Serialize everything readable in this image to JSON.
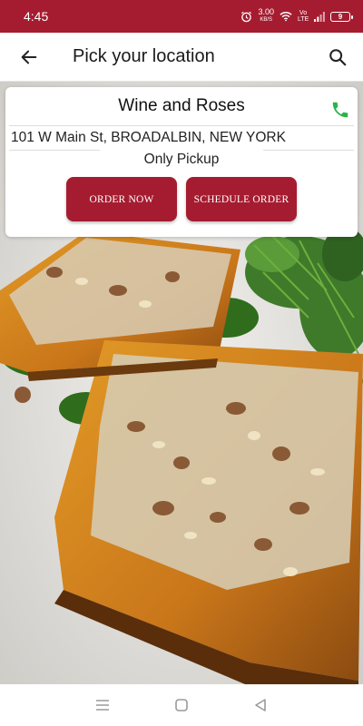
{
  "status_bar": {
    "time": "4:45",
    "net_speed": "3.00",
    "net_unit": "KB/S",
    "signal_label": "Vo LTE",
    "battery": "9"
  },
  "app_bar": {
    "title": "Pick your location"
  },
  "store": {
    "name": "Wine and Roses",
    "address": "101 W Main St, BROADALBIN, NEW YORK",
    "pickup_label": "Only Pickup",
    "order_now_label": "ORDER NOW",
    "schedule_order_label": "SCHEDULE ORDER"
  },
  "colors": {
    "brand": "#a51c30",
    "call_icon": "#2bb24c"
  },
  "icons": {
    "back": "arrow-left-icon",
    "search": "search-icon",
    "call": "phone-icon",
    "nav_menu": "menu-icon",
    "nav_home": "square-icon",
    "nav_back": "triangle-back-icon"
  }
}
